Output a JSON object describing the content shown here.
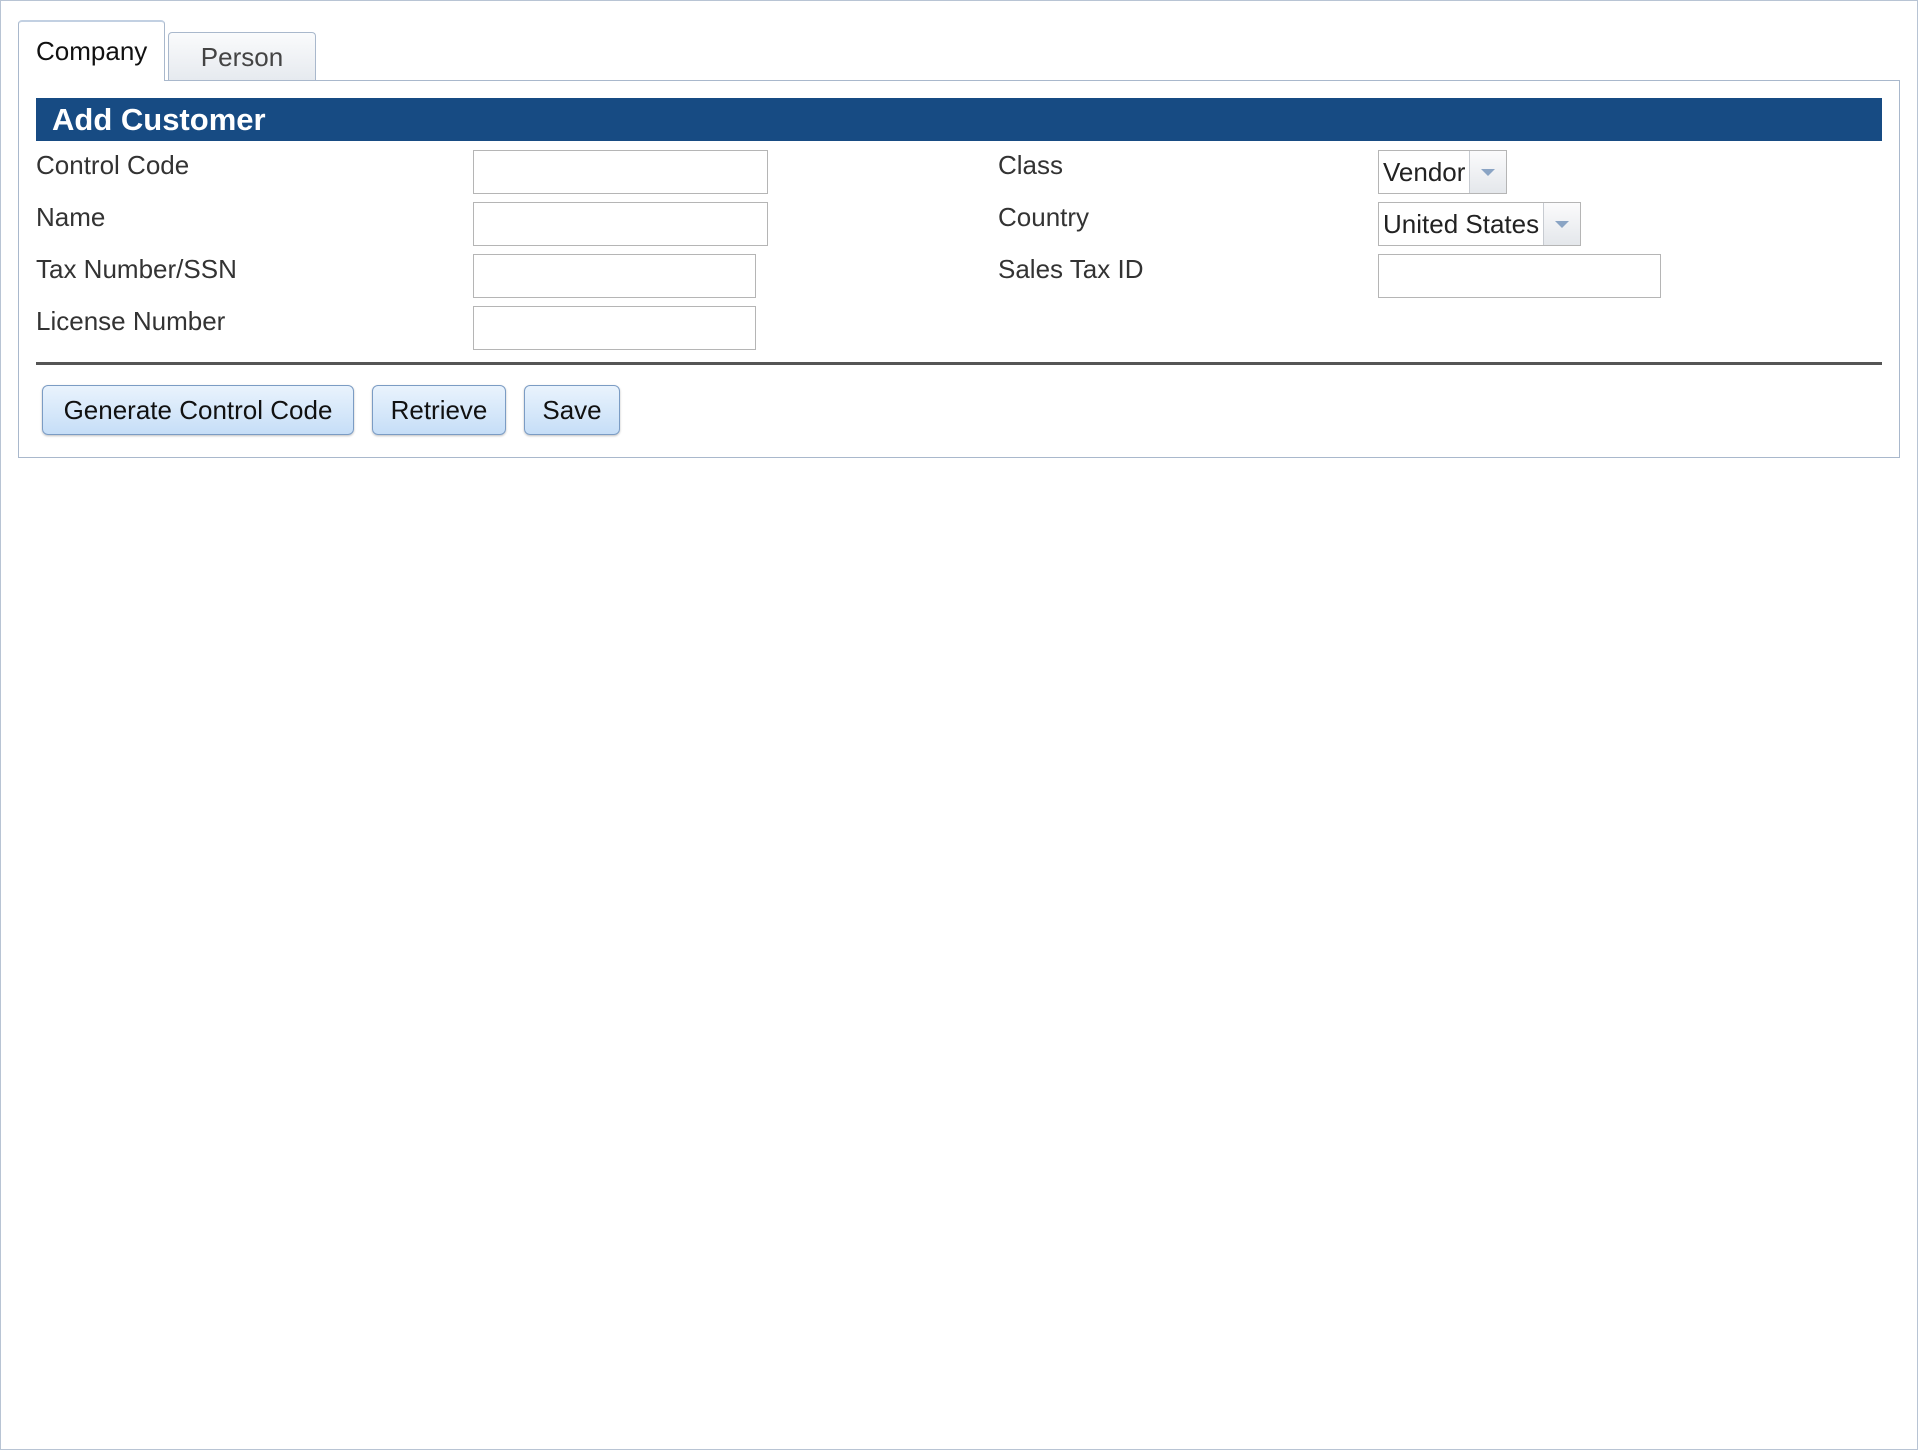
{
  "tabs": [
    {
      "label": "Company",
      "active": true
    },
    {
      "label": "Person",
      "active": false
    }
  ],
  "form": {
    "title": "Add Customer",
    "left_fields": [
      {
        "label": "Control Code",
        "value": ""
      },
      {
        "label": "Name",
        "value": ""
      },
      {
        "label": "Tax Number/SSN",
        "value": ""
      },
      {
        "label": "License Number",
        "value": ""
      }
    ],
    "right_fields": {
      "class": {
        "label": "Class",
        "selected": "Vendor"
      },
      "country": {
        "label": "Country",
        "selected": "United States"
      },
      "sales_tax_id": {
        "label": "Sales Tax ID",
        "value": ""
      }
    }
  },
  "buttons": {
    "generate": "Generate Control Code",
    "retrieve": "Retrieve",
    "save": "Save"
  },
  "colors": {
    "header_bg": "#174b83",
    "button_bg": "#c6def7",
    "border": "#a9b8cc"
  }
}
